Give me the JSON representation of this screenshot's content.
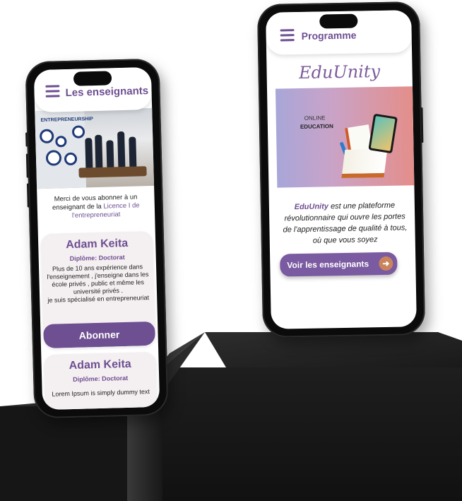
{
  "left_phone": {
    "header_title": "Les enseignants",
    "photo_label": "ENTREPRENEURSHIP",
    "intro": {
      "prefix": "Merci de vous abonner à un enseignant de la",
      "highlight": "Licence I de l'entrepreneuriat"
    },
    "teachers": [
      {
        "name": "Adam Keita",
        "diploma": "Diplôme:  Doctorat",
        "bio": "Plus de 10 ans expérience dans l'enseignement , j'enseigne dans les école privés , public et même les université privés .\nje suis spécialisé en entrepreneuriat",
        "subscribe_label": "Abonner"
      },
      {
        "name": "Adam Keita",
        "diploma": "Diplôme:  Doctorat",
        "bio": "Lorem Ipsum is simply dummy text"
      }
    ]
  },
  "right_phone": {
    "header_title": "Programme",
    "logo": "EduUnity",
    "banner": {
      "line1": "ONLINE",
      "line2": "EDUCATION"
    },
    "description": {
      "brand": "EduUnity",
      "text": " est une plateforme révolutionnaire qui ouvre les portes de l'apprentissage de qualité à tous, où que vous soyez"
    },
    "cta_label": "Voir les enseignants",
    "cta_icon": "arrow-right-icon"
  },
  "colors": {
    "accent": "#6e4f92",
    "button": "#7a5aa0",
    "card_bg": "#f4eff0",
    "phone_body": "#0b0b0b"
  }
}
